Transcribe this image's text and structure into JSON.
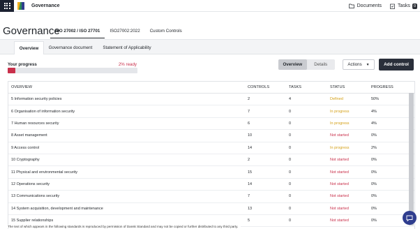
{
  "app": {
    "title": "Governance"
  },
  "topbar": {
    "documents_label": "Documents",
    "tasks_label": "Tasks",
    "tasks_count": "0"
  },
  "page": {
    "title": "Governance",
    "standard_tabs": [
      "ISO 27002 / ISO 27701",
      "ISO27002:2022",
      "Custom Controls"
    ],
    "active_standard_tab": 0,
    "sub_tabs": [
      "Overview",
      "Governance document",
      "Statement of Applicability"
    ],
    "active_sub_tab": 0
  },
  "progress": {
    "label": "Your progress",
    "percent_text": "2% ready",
    "value": 0.06
  },
  "view_toggle": {
    "options": [
      "Overview",
      "Details"
    ],
    "active": 0
  },
  "actions_label": "Actions",
  "add_control_label": "Add control",
  "table": {
    "headers": [
      "OVERVIEW",
      "CONTROLS",
      "TASKS",
      "STATUS",
      "PROGRESS"
    ],
    "rows": [
      {
        "name": "5 Information security policies",
        "controls": "2",
        "tasks": "4",
        "status": "Defined",
        "progress": "50%"
      },
      {
        "name": "6 Organisation of information security",
        "controls": "7",
        "tasks": "0",
        "status": "In progress",
        "progress": "4%"
      },
      {
        "name": "7 Human resources security",
        "controls": "6",
        "tasks": "0",
        "status": "In progress",
        "progress": "4%"
      },
      {
        "name": "8 Asset management",
        "controls": "10",
        "tasks": "0",
        "status": "Not started",
        "progress": "0%"
      },
      {
        "name": "9 Access control",
        "controls": "14",
        "tasks": "0",
        "status": "In progress",
        "progress": "2%"
      },
      {
        "name": "10 Cryptography",
        "controls": "2",
        "tasks": "0",
        "status": "Not started",
        "progress": "0%"
      },
      {
        "name": "11 Physical and environmental security",
        "controls": "15",
        "tasks": "0",
        "status": "Not started",
        "progress": "0%"
      },
      {
        "name": "12 Operations security",
        "controls": "14",
        "tasks": "0",
        "status": "Not started",
        "progress": "0%"
      },
      {
        "name": "13 Communications security",
        "controls": "7",
        "tasks": "0",
        "status": "Not started",
        "progress": "0%"
      },
      {
        "name": "14 System acquisition, development and maintenance",
        "controls": "13",
        "tasks": "0",
        "status": "Not started",
        "progress": "0%"
      },
      {
        "name": "15 Supplier relationships",
        "controls": "5",
        "tasks": "0",
        "status": "Not started",
        "progress": "0%"
      }
    ]
  },
  "footer_text": "The text of which appears in the following standards is reproduced by permission of Dansk Standard and may not be copied or further distributed to any third party.",
  "colors": {
    "accent_red": "#c9304b",
    "status_yellow": "#d4a017",
    "dark_button": "#2a2f3a",
    "chat_blue": "#2f3d8e"
  },
  "icons": [
    "apps-grid-icon",
    "logo-icon",
    "folder-icon",
    "tasks-icon",
    "chat-icon"
  ]
}
